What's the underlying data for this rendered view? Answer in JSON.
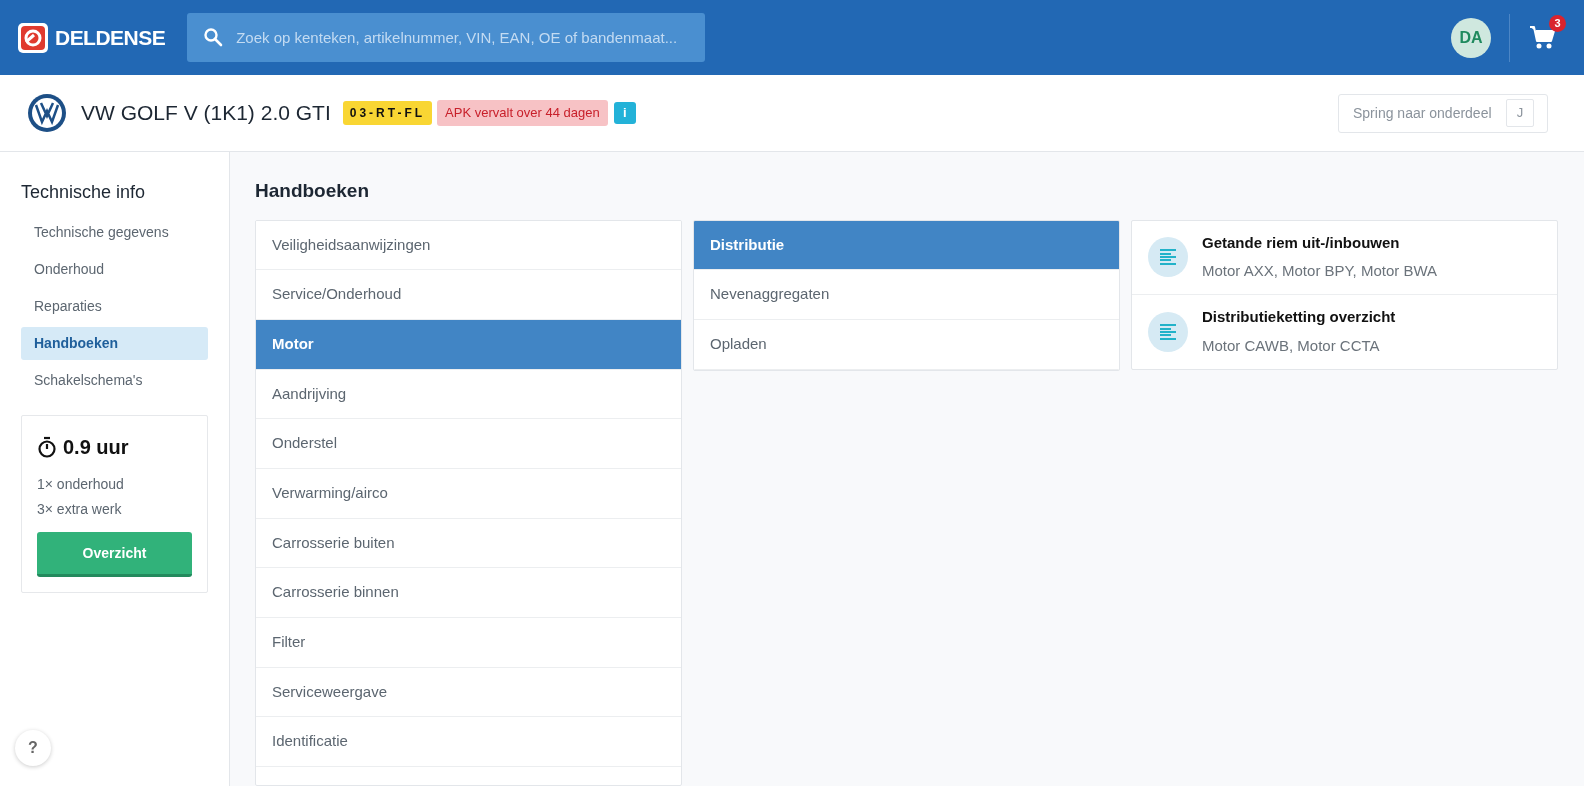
{
  "header": {
    "logo_text": "DELDENSE",
    "search": {
      "placeholder": "Zoek op kenteken, artikelnummer, VIN, EAN, OE of bandenmaat..."
    },
    "avatar": "DA",
    "cart_count": "3"
  },
  "vehicle": {
    "name": "VW GOLF V (1K1) 2.0 GTI",
    "plate": "03-RT-FL",
    "apk": "APK vervalt over 44 dagen",
    "info": "i",
    "jump": {
      "placeholder": "Spring naar onderdeel",
      "shortcut": "J"
    }
  },
  "sidebar": {
    "title": "Technische info",
    "items": [
      {
        "label": "Technische gegevens",
        "selected": false
      },
      {
        "label": "Onderhoud",
        "selected": false
      },
      {
        "label": "Reparaties",
        "selected": false
      },
      {
        "label": "Handboeken",
        "selected": true
      },
      {
        "label": "Schakelschema's",
        "selected": false
      }
    ],
    "time_card": {
      "hours": "0.9 uur",
      "lines": [
        "1× onderhoud",
        "3× extra werk"
      ],
      "button": "Overzicht"
    },
    "help": "?"
  },
  "main": {
    "title": "Handboeken",
    "categories": [
      {
        "label": "Veiligheidsaanwijzingen",
        "selected": false
      },
      {
        "label": "Service/Onderhoud",
        "selected": false
      },
      {
        "label": "Motor",
        "selected": true
      },
      {
        "label": "Aandrijving",
        "selected": false
      },
      {
        "label": "Onderstel",
        "selected": false
      },
      {
        "label": "Verwarming/airco",
        "selected": false
      },
      {
        "label": "Carrosserie buiten",
        "selected": false
      },
      {
        "label": "Carrosserie binnen",
        "selected": false
      },
      {
        "label": "Filter",
        "selected": false
      },
      {
        "label": "Serviceweergave",
        "selected": false
      },
      {
        "label": "Identificatie",
        "selected": false
      }
    ],
    "subcategories": [
      {
        "label": "Distributie",
        "selected": true
      },
      {
        "label": "Nevenaggregaten",
        "selected": false
      },
      {
        "label": "Opladen",
        "selected": false
      }
    ],
    "documents": [
      {
        "title": "Getande riem uit-/inbouwen",
        "engines": "Motor AXX, Motor BPY, Motor BWA"
      },
      {
        "title": "Distributieketting overzicht",
        "engines": "Motor CAWB, Motor CCTA"
      }
    ]
  }
}
